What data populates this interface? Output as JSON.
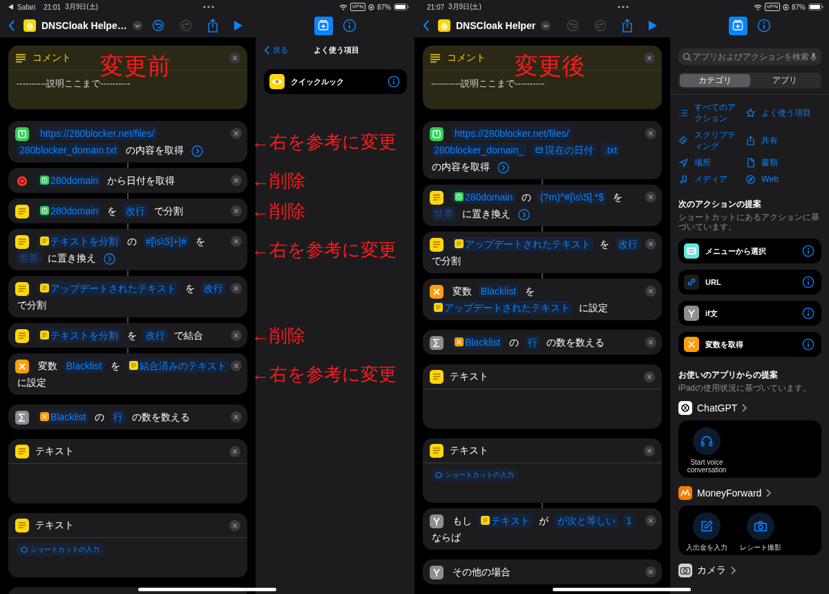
{
  "screens": [
    {
      "status": {
        "back_app": "Safari",
        "time": "21:01",
        "date": "3月9日(土)",
        "vpn": "VPN",
        "battery": "87%"
      },
      "toolbar": {
        "title": "DNSCloak Helpe…",
        "undo_enabled": true
      },
      "comment": {
        "label": "コメント",
        "body": "----------説明ここまで----------",
        "overlay": "変更前"
      },
      "actions": [
        {
          "kind": "web",
          "linked": false,
          "note": "←右を参考に変更",
          "parts": [
            {
              "kind": "token",
              "t": "https://280blocker.net/files/"
            },
            {
              "kind": "token",
              "t": "280blocker_domain.txt"
            },
            {
              "kind": "text",
              "t": "の内容を取得"
            },
            {
              "kind": "more"
            }
          ]
        },
        {
          "kind": "date",
          "linked": true,
          "note": "←削除",
          "parts": [
            {
              "kind": "web_token",
              "t": "280domain"
            },
            {
              "kind": "text",
              "t": "から日付を取得"
            }
          ]
        },
        {
          "kind": "text",
          "linked": true,
          "note": "←削除",
          "parts": [
            {
              "kind": "web_token",
              "t": "280domain"
            },
            {
              "kind": "text",
              "t": "を"
            },
            {
              "kind": "token",
              "t": "改行"
            },
            {
              "kind": "text",
              "t": "で分割"
            }
          ]
        },
        {
          "kind": "text",
          "linked": true,
          "note": "←右を参考に変更",
          "parts": [
            {
              "kind": "text_token",
              "t": "テキストを分割"
            },
            {
              "kind": "text",
              "t": "の"
            },
            {
              "kind": "token",
              "t": "#[\\s\\S]+|#"
            },
            {
              "kind": "text",
              "t": "を"
            },
            {
              "kind": "placeholder",
              "t": "世界"
            },
            {
              "kind": "text",
              "t": "に置き換え"
            },
            {
              "kind": "more"
            }
          ]
        },
        {
          "kind": "text",
          "linked": true,
          "parts": [
            {
              "kind": "text_token",
              "t": "アップデートされたテキスト"
            },
            {
              "kind": "text",
              "t": "を"
            },
            {
              "kind": "token",
              "t": "改行"
            },
            {
              "kind": "text",
              "t": "で分割"
            }
          ]
        },
        {
          "kind": "text",
          "linked": true,
          "note": "←削除",
          "parts": [
            {
              "kind": "text_token",
              "t": "テキストを分割"
            },
            {
              "kind": "text",
              "t": "を"
            },
            {
              "kind": "token",
              "t": "改行"
            },
            {
              "kind": "text",
              "t": "で結合"
            }
          ]
        },
        {
          "kind": "variable",
          "linked": true,
          "note": "←右を参考に変更",
          "parts": [
            {
              "kind": "text",
              "t": "変数"
            },
            {
              "kind": "token",
              "t": "Blacklist"
            },
            {
              "kind": "text",
              "t": "を"
            },
            {
              "kind": "text_token",
              "t": "結合済みのテキスト"
            },
            {
              "kind": "text",
              "t": "に設定"
            }
          ]
        },
        {
          "kind": "count",
          "linked": false,
          "parts": [
            {
              "kind": "variable_token",
              "t": "Blacklist"
            },
            {
              "kind": "text",
              "t": "の"
            },
            {
              "kind": "token",
              "t": "行"
            },
            {
              "kind": "text",
              "t": "の数を数える"
            }
          ]
        },
        {
          "kind": "text_block",
          "linked": false,
          "label": "テキスト"
        },
        {
          "kind": "text_block",
          "linked": false,
          "label": "テキスト",
          "chip": "ショートカットの入力"
        }
      ],
      "panel": {
        "kind": "favorites",
        "back": "戻る",
        "title": "よく使う項目",
        "items": [
          {
            "label": "クイックルック"
          }
        ]
      }
    },
    {
      "status": {
        "time": "21:07",
        "date": "3月9日(土)",
        "vpn": "VPN",
        "battery": "87%"
      },
      "toolbar": {
        "title": "DNSCloak Helper",
        "undo_enabled": false
      },
      "comment": {
        "label": "コメント",
        "body": "----------説明ここまで----------",
        "overlay": "変更後"
      },
      "actions": [
        {
          "kind": "web",
          "linked": false,
          "parts": [
            {
              "kind": "token",
              "t": "https://280blocker.net/files/"
            },
            {
              "kind": "token",
              "t": "280blocker_domain_"
            },
            {
              "kind": "date_token",
              "t": "現在の日付"
            },
            {
              "kind": "token",
              "t": ".txt"
            },
            {
              "kind": "text",
              "t": "の内容を取得"
            },
            {
              "kind": "more"
            }
          ]
        },
        {
          "kind": "text",
          "linked": true,
          "parts": [
            {
              "kind": "web_token",
              "t": "280domain"
            },
            {
              "kind": "text",
              "t": "の"
            },
            {
              "kind": "token",
              "t": "(?m)^#[\\s\\S].*$"
            },
            {
              "kind": "text",
              "t": "を"
            },
            {
              "kind": "placeholder",
              "t": "世界"
            },
            {
              "kind": "text",
              "t": "に置き換え"
            },
            {
              "kind": "more"
            }
          ]
        },
        {
          "kind": "text",
          "linked": true,
          "parts": [
            {
              "kind": "text_token",
              "t": "アップデートされたテキスト"
            },
            {
              "kind": "text",
              "t": "を"
            },
            {
              "kind": "token",
              "t": "改行"
            },
            {
              "kind": "text",
              "t": "で分割"
            }
          ]
        },
        {
          "kind": "variable",
          "linked": true,
          "parts": [
            {
              "kind": "text",
              "t": "変数"
            },
            {
              "kind": "token",
              "t": "Blacklist"
            },
            {
              "kind": "text",
              "t": "を"
            },
            {
              "kind": "text_token",
              "t": "アップデートされたテキスト"
            },
            {
              "kind": "text",
              "t": "に設定"
            }
          ]
        },
        {
          "kind": "count",
          "linked": false,
          "parts": [
            {
              "kind": "variable_token",
              "t": "Blacklist"
            },
            {
              "kind": "text",
              "t": "の"
            },
            {
              "kind": "token",
              "t": "行"
            },
            {
              "kind": "text",
              "t": "の数を数える"
            }
          ]
        },
        {
          "kind": "text_block",
          "linked": false,
          "label": "テキスト"
        },
        {
          "kind": "text_block",
          "linked": false,
          "label": "テキスト",
          "chip": "ショートカットの入力"
        },
        {
          "kind": "if",
          "linked": true,
          "parts": [
            {
              "kind": "text",
              "t": "もし"
            },
            {
              "kind": "text_token",
              "t": "テキスト"
            },
            {
              "kind": "text",
              "t": "が"
            },
            {
              "kind": "token",
              "t": "が次と等しい"
            },
            {
              "kind": "token",
              "t": "1"
            },
            {
              "kind": "text",
              "t": "ならば"
            }
          ]
        },
        {
          "kind": "if",
          "linked": false,
          "parts": [
            {
              "kind": "text",
              "t": "その他の場合"
            }
          ]
        }
      ],
      "panel": {
        "kind": "categories",
        "search": {
          "placeholder": "アプリおよびアクションを検索"
        },
        "segments": [
          {
            "label": "カテゴリ",
            "selected": true
          },
          {
            "label": "アプリ",
            "selected": false
          }
        ],
        "categories": [
          {
            "label": "すべてのアクション",
            "kind": "list"
          },
          {
            "label": "よく使う項目",
            "kind": "star"
          },
          {
            "label": "スクリプティング",
            "kind": "script"
          },
          {
            "label": "共有",
            "kind": "share"
          },
          {
            "label": "場所",
            "kind": "location"
          },
          {
            "label": "書類",
            "kind": "document"
          },
          {
            "label": "メディア",
            "kind": "music"
          },
          {
            "label": "Web",
            "kind": "compass"
          }
        ],
        "suggestions": {
          "title": "次のアクションの提案",
          "subtitle": "ショートカットにあるアクションに基づいています。",
          "items": [
            {
              "label": "メニューから選択",
              "kind": "menu"
            },
            {
              "label": "URL",
              "kind": "link"
            },
            {
              "label": "if文",
              "kind": "if"
            },
            {
              "label": "変数を取得",
              "kind": "variable"
            }
          ]
        },
        "apps": {
          "title": "お使いのアプリからの提案",
          "subtitle": "iPadの使用状況に基づいています。",
          "items": [
            {
              "name": "ChatGPT",
              "kind": "chatgpt",
              "actions": [
                {
                  "label": "Start voice conversation",
                  "kind": "headphones"
                }
              ]
            },
            {
              "name": "MoneyForward",
              "kind": "moneyforward",
              "actions": [
                {
                  "label": "入出金を入力",
                  "kind": "edit"
                },
                {
                  "label": "レシート撮影",
                  "kind": "camera"
                }
              ]
            },
            {
              "name": "カメラ",
              "kind": "camera"
            }
          ]
        }
      }
    }
  ]
}
